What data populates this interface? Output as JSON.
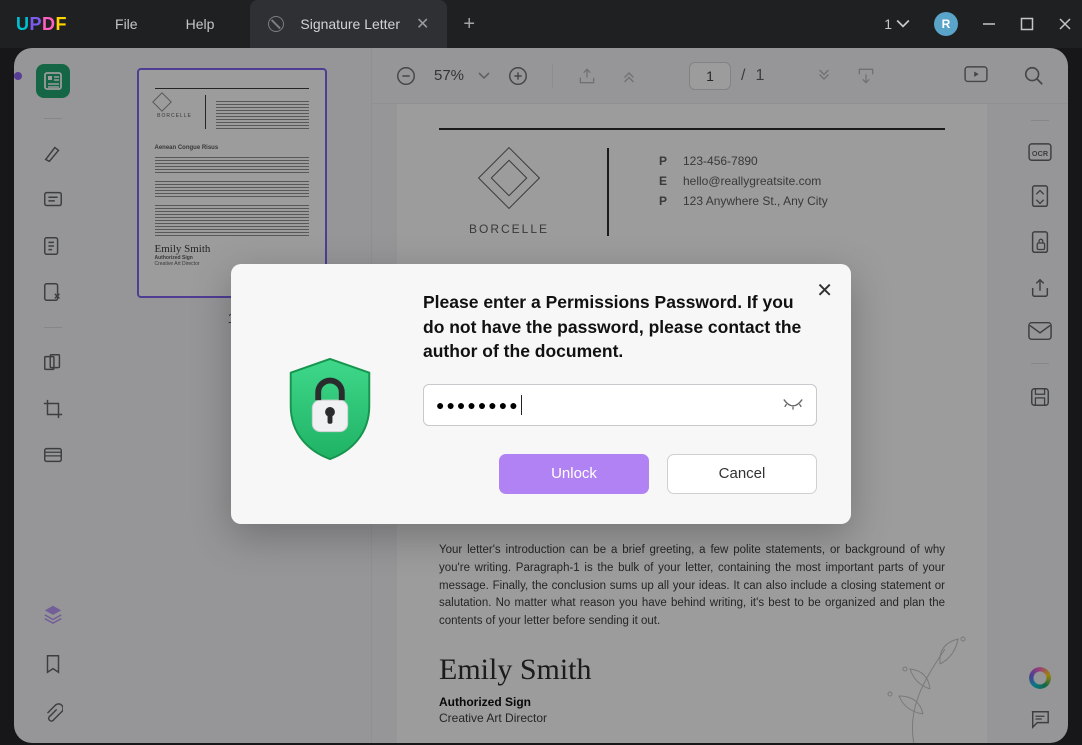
{
  "app": {
    "logo": "UPDF"
  },
  "menu": {
    "file": "File",
    "help": "Help"
  },
  "tabs": {
    "count": "1",
    "items": [
      {
        "title": "Signature Letter"
      }
    ]
  },
  "window": {
    "avatar_initial": "R"
  },
  "toolbar": {
    "zoom": "57%",
    "page_current": "1",
    "page_sep": "/",
    "page_total": "1"
  },
  "thumbnails": {
    "page1_num": "1"
  },
  "document": {
    "brand": "BORCELLE",
    "contacts": {
      "phone_k": "P",
      "phone_v": "123-456-7890",
      "email_k": "E",
      "email_v": "hello@reallygreatsite.com",
      "addr_k": "P",
      "addr_v": "123 Anywhere St., Any City"
    },
    "paragraph": "Your letter's introduction can be a brief greeting, a few polite statements, or background of why you're writing. Paragraph-1 is the bulk of your letter, containing the most important parts of your message. Finally, the conclusion sums up all your ideas. It can also include a closing statement or salutation. No matter what reason you have behind writing, it's best to be organized and plan the contents of your letter before sending it out.",
    "signature_name": "Emily Smith",
    "signature_role1": "Authorized Sign",
    "signature_role2": "Creative Art Director"
  },
  "modal": {
    "message": "Please enter a Permissions Password. If you do not have the password, please contact the author of the document.",
    "password_mask": "●●●●●●●●",
    "unlock": "Unlock",
    "cancel": "Cancel"
  },
  "icons": {
    "thumbnails": "thumbnails-icon",
    "highlighter": "highlighter-icon",
    "comment": "comment-icon",
    "edit": "edit-pdf-icon",
    "sign": "fill-sign-icon",
    "page_org": "page-organize-icon",
    "crop": "crop-icon",
    "redact": "redact-icon",
    "layers": "layers-icon",
    "bookmark": "bookmark-icon",
    "attach": "attachment-icon",
    "zoom_out": "zoom-out-icon",
    "zoom_in": "zoom-in-icon",
    "fitpage": "fit-page-icon",
    "gototop": "go-top-icon",
    "nextpage": "next-page-icon",
    "lastpage": "last-page-icon",
    "present": "present-icon",
    "search": "search-icon",
    "ocr": "ocr-icon",
    "convert": "convert-icon",
    "protect": "protect-icon",
    "share": "share-icon",
    "mail": "mail-icon",
    "save": "save-icon",
    "ai": "ai-icon",
    "chat": "chat-icon"
  }
}
